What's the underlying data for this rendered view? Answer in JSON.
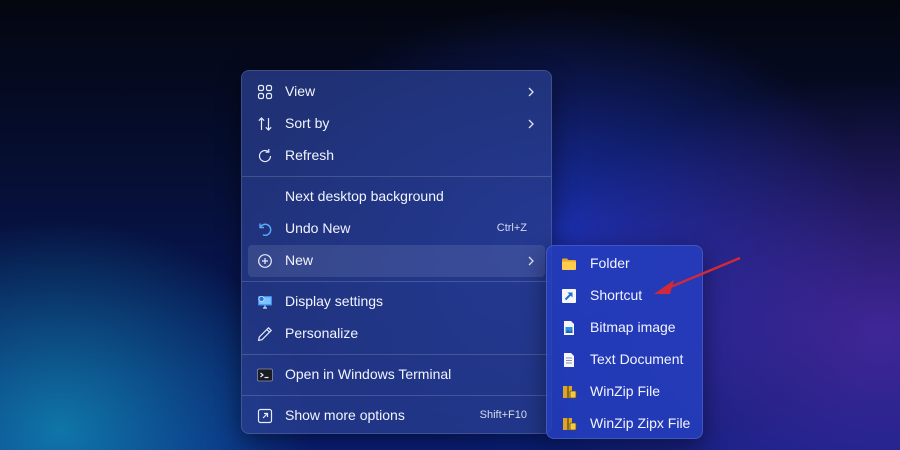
{
  "context_menu": {
    "items": [
      {
        "label": "View",
        "icon": "grid-icon"
      },
      {
        "label": "Sort by",
        "icon": "sort-arrows-icon"
      },
      {
        "label": "Refresh",
        "icon": "refresh-icon"
      },
      {
        "label": "Next desktop background"
      },
      {
        "label": "Undo New",
        "icon": "undo-icon",
        "shortcut": "Ctrl+Z"
      },
      {
        "label": "New",
        "icon": "add-circle-icon"
      },
      {
        "label": "Display settings",
        "icon": "display-settings-icon"
      },
      {
        "label": "Personalize",
        "icon": "pen-icon"
      },
      {
        "label": "Open in Windows Terminal",
        "icon": "terminal-icon"
      },
      {
        "label": "Show more options",
        "icon": "expand-icon",
        "shortcut": "Shift+F10"
      }
    ],
    "highlighted": "New"
  },
  "new_submenu": {
    "items": [
      {
        "label": "Folder",
        "icon": "folder-icon"
      },
      {
        "label": "Shortcut",
        "icon": "shortcut-icon"
      },
      {
        "label": "Bitmap image",
        "icon": "bitmap-icon"
      },
      {
        "label": "Text Document",
        "icon": "text-document-icon"
      },
      {
        "label": "WinZip File",
        "icon": "winzip-icon"
      },
      {
        "label": "WinZip Zipx File",
        "icon": "winzip-zipx-icon"
      }
    ]
  },
  "colors": {
    "annotation_arrow": "#d02a3a",
    "accent": "#5aa9ff"
  }
}
